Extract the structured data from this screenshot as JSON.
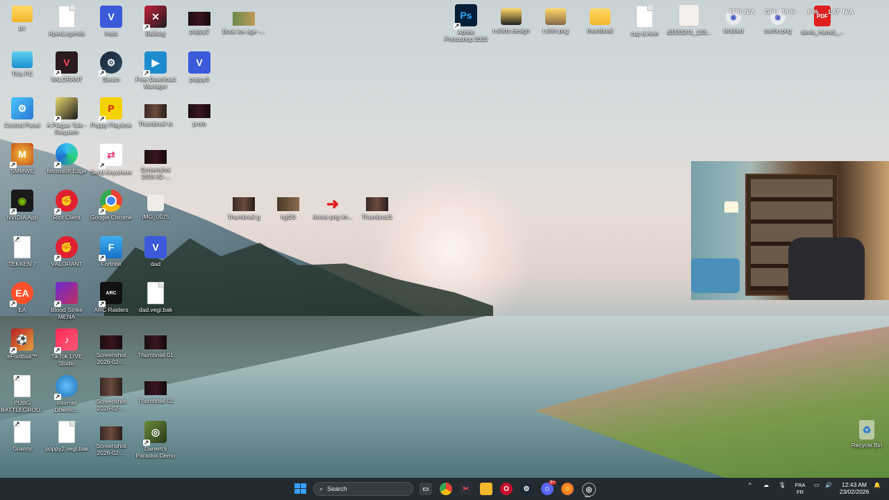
{
  "desktop_icons": [
    {
      "label": "pc"
    },
    {
      "label": "ApexLegends"
    },
    {
      "label": "Insta"
    },
    {
      "label": "Ballbag"
    },
    {
      "label": "poppy2"
    },
    {
      "label": "Book ice age -..."
    },
    {
      "label": "This PC"
    },
    {
      "label": "VALORANT"
    },
    {
      "label": "Steam"
    },
    {
      "label": "Free Download Manager"
    },
    {
      "label": "poppy3"
    },
    {
      "label": "Control Panel"
    },
    {
      "label": "A Plague Tale - Requiem"
    },
    {
      "label": "Poppy Playtime"
    },
    {
      "label": "Thumbnail to"
    },
    {
      "label": "proto"
    },
    {
      "label": "SMMWE"
    },
    {
      "label": "Microsoft Edge"
    },
    {
      "label": "Send Anywhere"
    },
    {
      "label": "Screenshot 2026-02-..."
    },
    {
      "label": "NVIDIA App"
    },
    {
      "label": "Riot Client"
    },
    {
      "label": "Google Chrome"
    },
    {
      "label": "IMG_0075"
    },
    {
      "label": "Thumbnail g"
    },
    {
      "label": "hgf20"
    },
    {
      "label": "Arrow png im..."
    },
    {
      "label": "Thumbnail1"
    },
    {
      "label": "TEKKEN 7"
    },
    {
      "label": "VALORANT"
    },
    {
      "label": "Fortnite"
    },
    {
      "label": "dad"
    },
    {
      "label": "EA"
    },
    {
      "label": "Blood Strike MENA"
    },
    {
      "label": "ARC Raiders"
    },
    {
      "label": "dad.vegi.bak"
    },
    {
      "label": "eFootball™"
    },
    {
      "label": "TikTok LIVE Studio"
    },
    {
      "label": "Screenshot 2026-02-..."
    },
    {
      "label": "Thumbnail 01"
    },
    {
      "label": "PUBG BATTLEGROU..."
    },
    {
      "label": "Internet Downlo..."
    },
    {
      "label": "Screenshot 2026-02-..."
    },
    {
      "label": "Thumbnail 02"
    },
    {
      "label": "Granny"
    },
    {
      "label": "poppy2.vegi.bak"
    },
    {
      "label": "Screenshot 2026-02-..."
    },
    {
      "label": "Darwin's Paradox Demo"
    },
    {
      "label": "Adobe Photoshop 2020"
    },
    {
      "label": "t-shirts design"
    },
    {
      "label": "t shirt png"
    },
    {
      "label": "thumbnail"
    },
    {
      "label": "cup d.Avin"
    },
    {
      "label": "d3333241_133..."
    },
    {
      "label": "Untitled"
    },
    {
      "label": "cache.png"
    },
    {
      "label": "devis_Hamdi_..."
    }
  ],
  "recycle_bin": {
    "label": "Recycle Bin"
  },
  "overlay": {
    "fps_label": "FPS",
    "fps_value": "N/A",
    "gpu_label": "GPU",
    "gpu_value": "38 %",
    "cpu_value": "8 %",
    "lat_label": "LAT",
    "lat_value": "N/A"
  },
  "taskbar": {
    "search_placeholder": "Search",
    "lang_top": "FRA",
    "lang_bottom": "FR",
    "time": "12:43 AM",
    "date": "23/02/2026",
    "steam_badge": "9+"
  },
  "colors": {
    "taskbar_bg": "#1e242a",
    "start_blue": "#3aa0ff"
  }
}
